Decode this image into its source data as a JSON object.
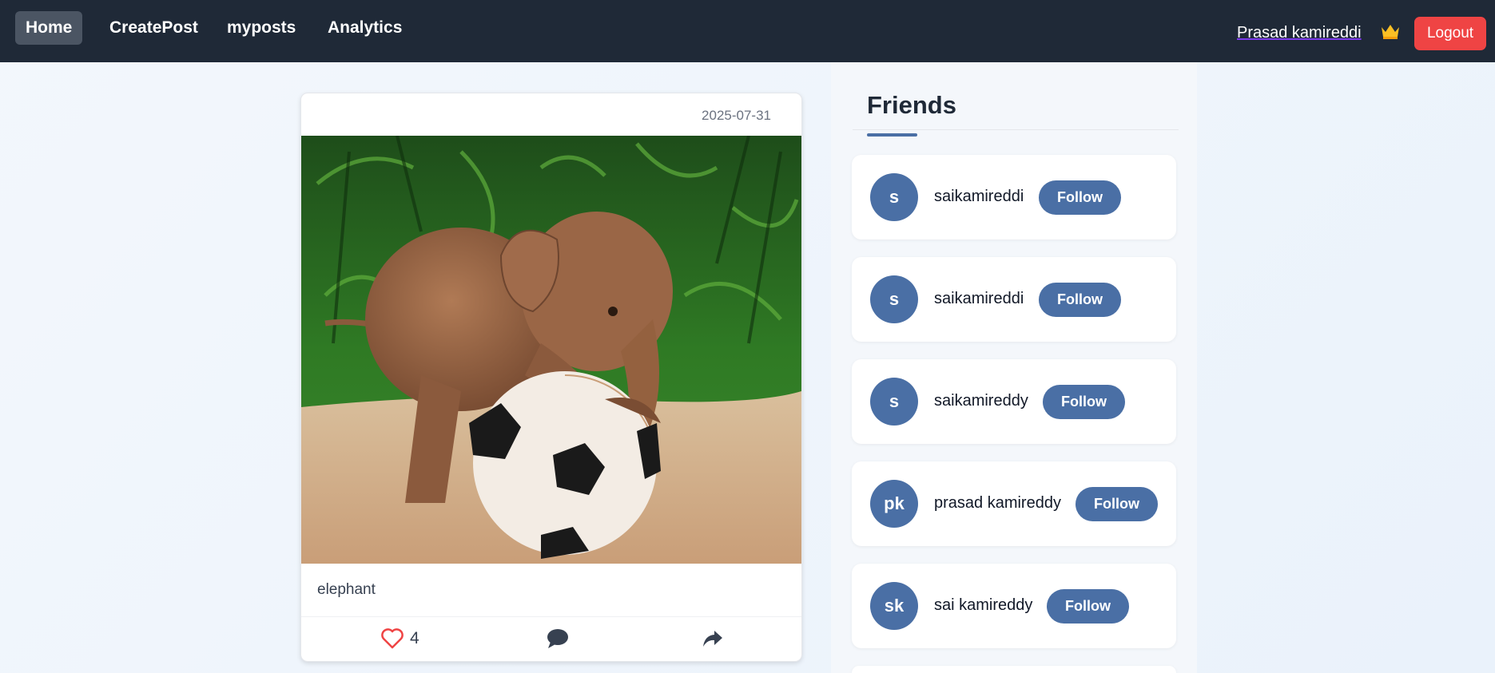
{
  "nav": {
    "home": "Home",
    "create_post": "CreatePost",
    "my_posts": "myposts",
    "analytics": "Analytics",
    "user_name": "Prasad kamireddi",
    "logout": "Logout",
    "crown_icon": "crown-icon",
    "colors": {
      "bar": "#1f2937",
      "active": "#4b5563",
      "logout": "#ef4444",
      "crown": "#fbbf24"
    }
  },
  "post": {
    "date": "2025-07-31",
    "image": "photo of baby elephant playing on a soccer ball",
    "caption": "elephant",
    "likes": "4",
    "icons": [
      "heart-icon",
      "comment-icon",
      "share-icon"
    ]
  },
  "friends": {
    "title": "Friends",
    "follow_label": "Follow",
    "items": [
      {
        "initials": "s",
        "name": "saikamireddi"
      },
      {
        "initials": "s",
        "name": "saikamireddi"
      },
      {
        "initials": "s",
        "name": "saikamireddy"
      },
      {
        "initials": "pk",
        "name": "prasad kamireddy"
      },
      {
        "initials": "sk",
        "name": "sai kamireddy"
      }
    ],
    "accent": "#4a6fa5"
  }
}
